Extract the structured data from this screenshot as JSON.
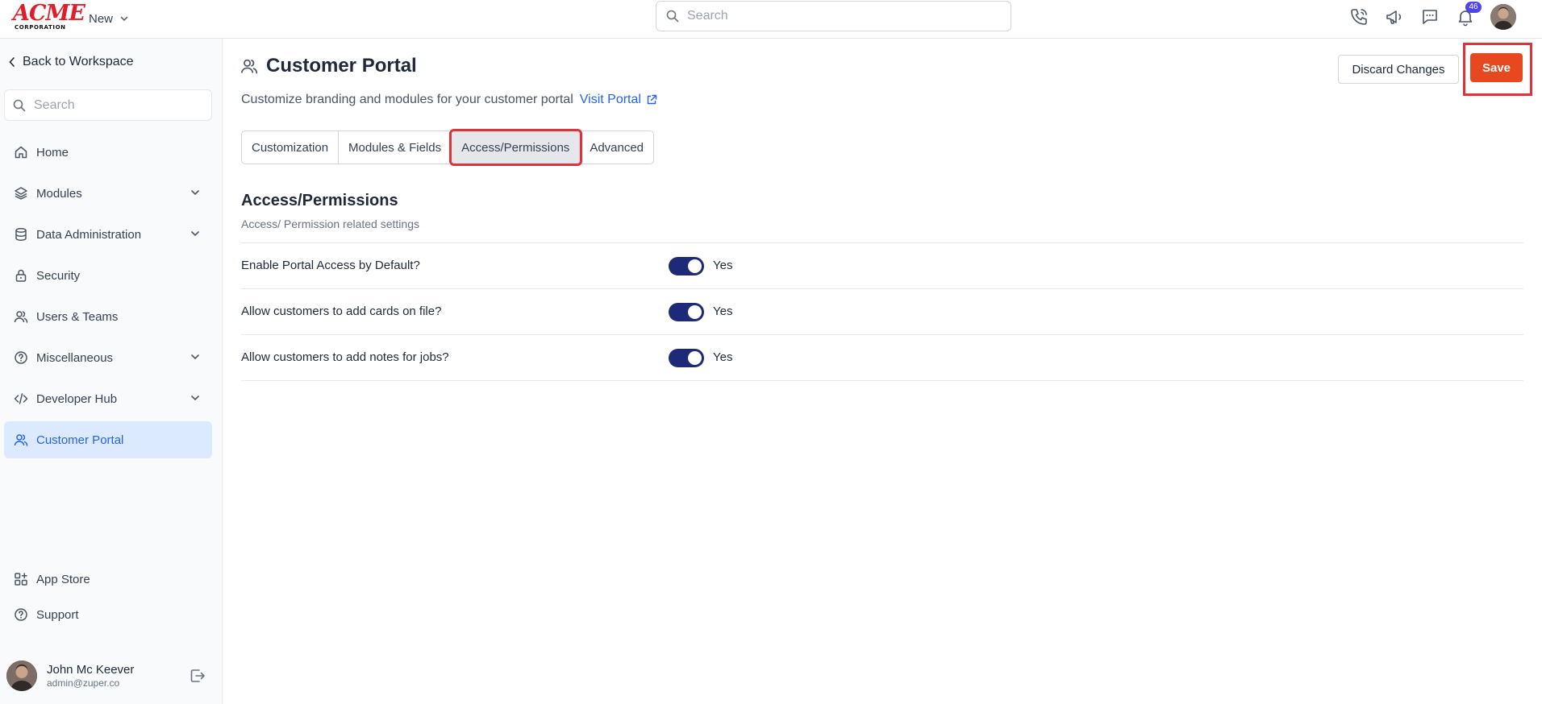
{
  "topbar": {
    "logo_main": "ACME",
    "logo_sub": "CORPORATION",
    "new_label": "New",
    "search_placeholder": "Search",
    "notification_count": "46"
  },
  "sidebar": {
    "back_label": "Back to Workspace",
    "search_placeholder": "Search",
    "items": [
      {
        "label": "Home",
        "icon": "home-icon",
        "expandable": false,
        "active": false
      },
      {
        "label": "Modules",
        "icon": "layers-icon",
        "expandable": true,
        "active": false
      },
      {
        "label": "Data Administration",
        "icon": "database-icon",
        "expandable": true,
        "active": false
      },
      {
        "label": "Security",
        "icon": "lock-icon",
        "expandable": false,
        "active": false
      },
      {
        "label": "Users & Teams",
        "icon": "users-icon",
        "expandable": false,
        "active": false
      },
      {
        "label": "Miscellaneous",
        "icon": "help-circle-icon",
        "expandable": true,
        "active": false
      },
      {
        "label": "Developer Hub",
        "icon": "code-icon",
        "expandable": true,
        "active": false
      },
      {
        "label": "Customer Portal",
        "icon": "users-icon",
        "expandable": false,
        "active": true
      }
    ],
    "bottom_items": [
      {
        "label": "App Store",
        "icon": "apps-icon"
      },
      {
        "label": "Support",
        "icon": "help-circle-icon"
      }
    ],
    "user": {
      "name": "John Mc Keever",
      "email": "admin@zuper.co"
    }
  },
  "main": {
    "title": "Customer Portal",
    "subtitle": "Customize branding and modules for your customer portal",
    "visit_link": "Visit Portal",
    "discard_label": "Discard Changes",
    "save_label": "Save",
    "tabs": [
      {
        "label": "Customization",
        "active": false
      },
      {
        "label": "Modules & Fields",
        "active": false
      },
      {
        "label": "Access/Permissions",
        "active": true
      },
      {
        "label": "Advanced",
        "active": false
      }
    ],
    "section_title": "Access/Permissions",
    "section_subtitle": "Access/ Permission related settings",
    "settings": [
      {
        "label": "Enable Portal Access by Default?",
        "value": "Yes",
        "enabled": true
      },
      {
        "label": "Allow customers to add cards on file?",
        "value": "Yes",
        "enabled": true
      },
      {
        "label": "Allow customers to add notes for jobs?",
        "value": "Yes",
        "enabled": true
      }
    ]
  },
  "colors": {
    "accent": "#2563eb",
    "save": "#e8481f",
    "toggle_on": "#1e2a78",
    "highlight": "#e0323b"
  }
}
